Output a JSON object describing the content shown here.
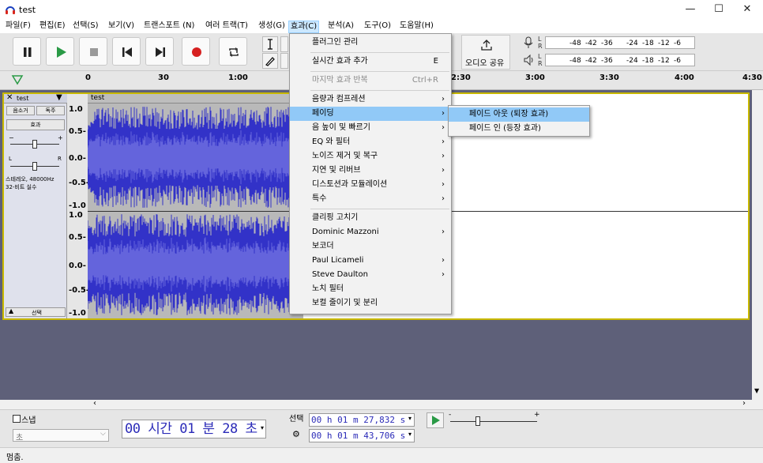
{
  "window": {
    "title": "test",
    "minimize": "—",
    "maximize": "☐",
    "close": "✕"
  },
  "menubar": [
    "파일(F)",
    "편집(E)",
    "선택(S)",
    "보기(V)",
    "트랜스포트 (N)",
    "여러 트랙(T)",
    "생성(G)",
    "효과(C)",
    "분석(A)",
    "도구(O)",
    "도움말(H)"
  ],
  "toolbar": {
    "share_label": "오디오 공유",
    "meter_scale": [
      "-48",
      "-42",
      "-36",
      "-24",
      "-18",
      "-12",
      "-6"
    ],
    "meter_channels": [
      "L",
      "R"
    ]
  },
  "ruler": {
    "ticks": [
      "0",
      "30",
      "1:00",
      "2:30",
      "3:00",
      "3:30",
      "4:00",
      "4:30"
    ]
  },
  "track": {
    "name": "test",
    "clip_name": "test",
    "mute": "음소거",
    "solo": "독주",
    "effects": "효과",
    "gain_minus": "−",
    "gain_plus": "+",
    "pan_left": "L",
    "pan_right": "R",
    "info_line1": "스테레오, 48000Hz",
    "info_line2": "32-비트 실수",
    "select": "선택",
    "vscale_top": [
      "1.0",
      "0.5-",
      "0.0-",
      "-0.5-",
      "-1.0"
    ],
    "vscale_bottom": [
      "1.0",
      "0.5-",
      "0.0-",
      "-0.5-",
      "-1.0"
    ]
  },
  "effects_menu": [
    {
      "label": "플러그인 관리",
      "shortcut": "",
      "submenu": false,
      "disabled": false
    },
    {
      "sep": true
    },
    {
      "label": "실시간 효과 추가",
      "shortcut": "E",
      "submenu": false,
      "disabled": false
    },
    {
      "sep": true
    },
    {
      "label": "마지막 효과 반복",
      "shortcut": "Ctrl+R",
      "submenu": false,
      "disabled": true
    },
    {
      "sep": true
    },
    {
      "label": "음량과 컴프레션",
      "shortcut": "",
      "submenu": true,
      "disabled": false
    },
    {
      "label": "페이딩",
      "shortcut": "",
      "submenu": true,
      "disabled": false,
      "highlight": true
    },
    {
      "label": "음 높이 및 빠르기",
      "shortcut": "",
      "submenu": true,
      "disabled": false
    },
    {
      "label": "EQ 와 필터",
      "shortcut": "",
      "submenu": true,
      "disabled": false
    },
    {
      "label": "노이즈 제거 및 복구",
      "shortcut": "",
      "submenu": true,
      "disabled": false
    },
    {
      "label": "지연 및 리버브",
      "shortcut": "",
      "submenu": true,
      "disabled": false
    },
    {
      "label": "디스토션과 모듈레이션",
      "shortcut": "",
      "submenu": true,
      "disabled": false
    },
    {
      "label": "특수",
      "shortcut": "",
      "submenu": true,
      "disabled": false
    },
    {
      "sep": true
    },
    {
      "label": "클리핑 고치기",
      "shortcut": "",
      "submenu": false,
      "disabled": false
    },
    {
      "label": "Dominic Mazzoni",
      "shortcut": "",
      "submenu": true,
      "disabled": false
    },
    {
      "label": "보코더",
      "shortcut": "",
      "submenu": false,
      "disabled": false
    },
    {
      "label": "Paul Licameli",
      "shortcut": "",
      "submenu": true,
      "disabled": false
    },
    {
      "label": "Steve Daulton",
      "shortcut": "",
      "submenu": true,
      "disabled": false
    },
    {
      "label": "노치 필터",
      "shortcut": "",
      "submenu": false,
      "disabled": false
    },
    {
      "label": "보컬 줄이기 및 분리",
      "shortcut": "",
      "submenu": false,
      "disabled": false
    }
  ],
  "fading_submenu": [
    {
      "label": "페이드 아웃 (퇴장 효과)",
      "highlight": true
    },
    {
      "label": "페이드 인 (등장 효과)",
      "highlight": false
    }
  ],
  "bottom": {
    "snap_label": "스냅",
    "snap_unit": "초",
    "time_display": "00 시간 01 분 28 초",
    "selection_label": "선택",
    "sel_start": "00 h 01 m 27,832 s",
    "sel_end": "00 h 01 m 43,706 s",
    "speed_minus": "-",
    "speed_plus": "+"
  },
  "status": {
    "text": "멈춤."
  },
  "colors": {
    "waveform": "#3232c8",
    "waveform_rms": "#6464dc",
    "track_bg": "#b9b9b9",
    "selected_border": "#c8b800",
    "track_area": "#5e6079"
  }
}
